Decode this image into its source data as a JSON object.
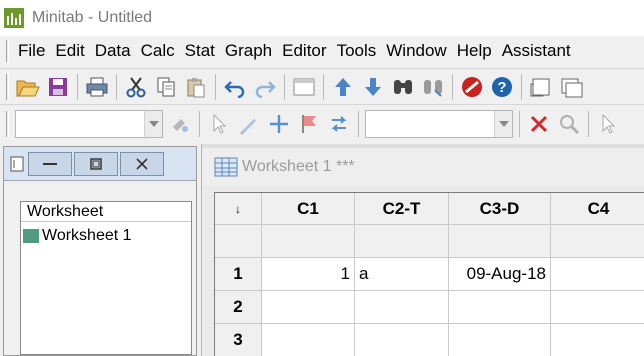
{
  "app": {
    "title": "Minitab - Untitled",
    "brand_color": "#6b9a2a"
  },
  "menu": [
    "File",
    "Edit",
    "Data",
    "Calc",
    "Stat",
    "Graph",
    "Editor",
    "Tools",
    "Window",
    "Help",
    "Assistant"
  ],
  "toolbar1": {
    "icons": [
      "open-icon",
      "save-icon",
      "print-icon",
      "cut-icon",
      "copy-icon",
      "paste-icon",
      "undo-icon",
      "redo-icon",
      "window-icon",
      "arrow-up-icon",
      "arrow-down-icon",
      "find-icon",
      "replace-icon",
      "cancel-icon",
      "help-icon",
      "session-window-icon",
      "data-window-icon"
    ]
  },
  "toolbar2": {
    "select1_value": "",
    "select2_value": "",
    "icons": [
      "brush-icon",
      "pointer-icon",
      "pen-icon",
      "crosshair-icon",
      "flag-icon",
      "swap-icon",
      "close-x-icon",
      "zoom-icon",
      "pointer-icon-2"
    ]
  },
  "project_manager": {
    "tree_header": "Worksheet",
    "nodes": [
      "Worksheet 1"
    ]
  },
  "worksheet": {
    "title": "Worksheet 1 ***",
    "corner": "↓",
    "columns": [
      "C1",
      "C2-T",
      "C3-D",
      "C4"
    ],
    "row_labels": [
      "1",
      "2",
      "3"
    ],
    "rows": [
      [
        "1",
        "a",
        "09-Aug-18",
        ""
      ],
      [
        "",
        "",
        "",
        ""
      ],
      [
        "",
        "",
        "",
        ""
      ]
    ]
  }
}
